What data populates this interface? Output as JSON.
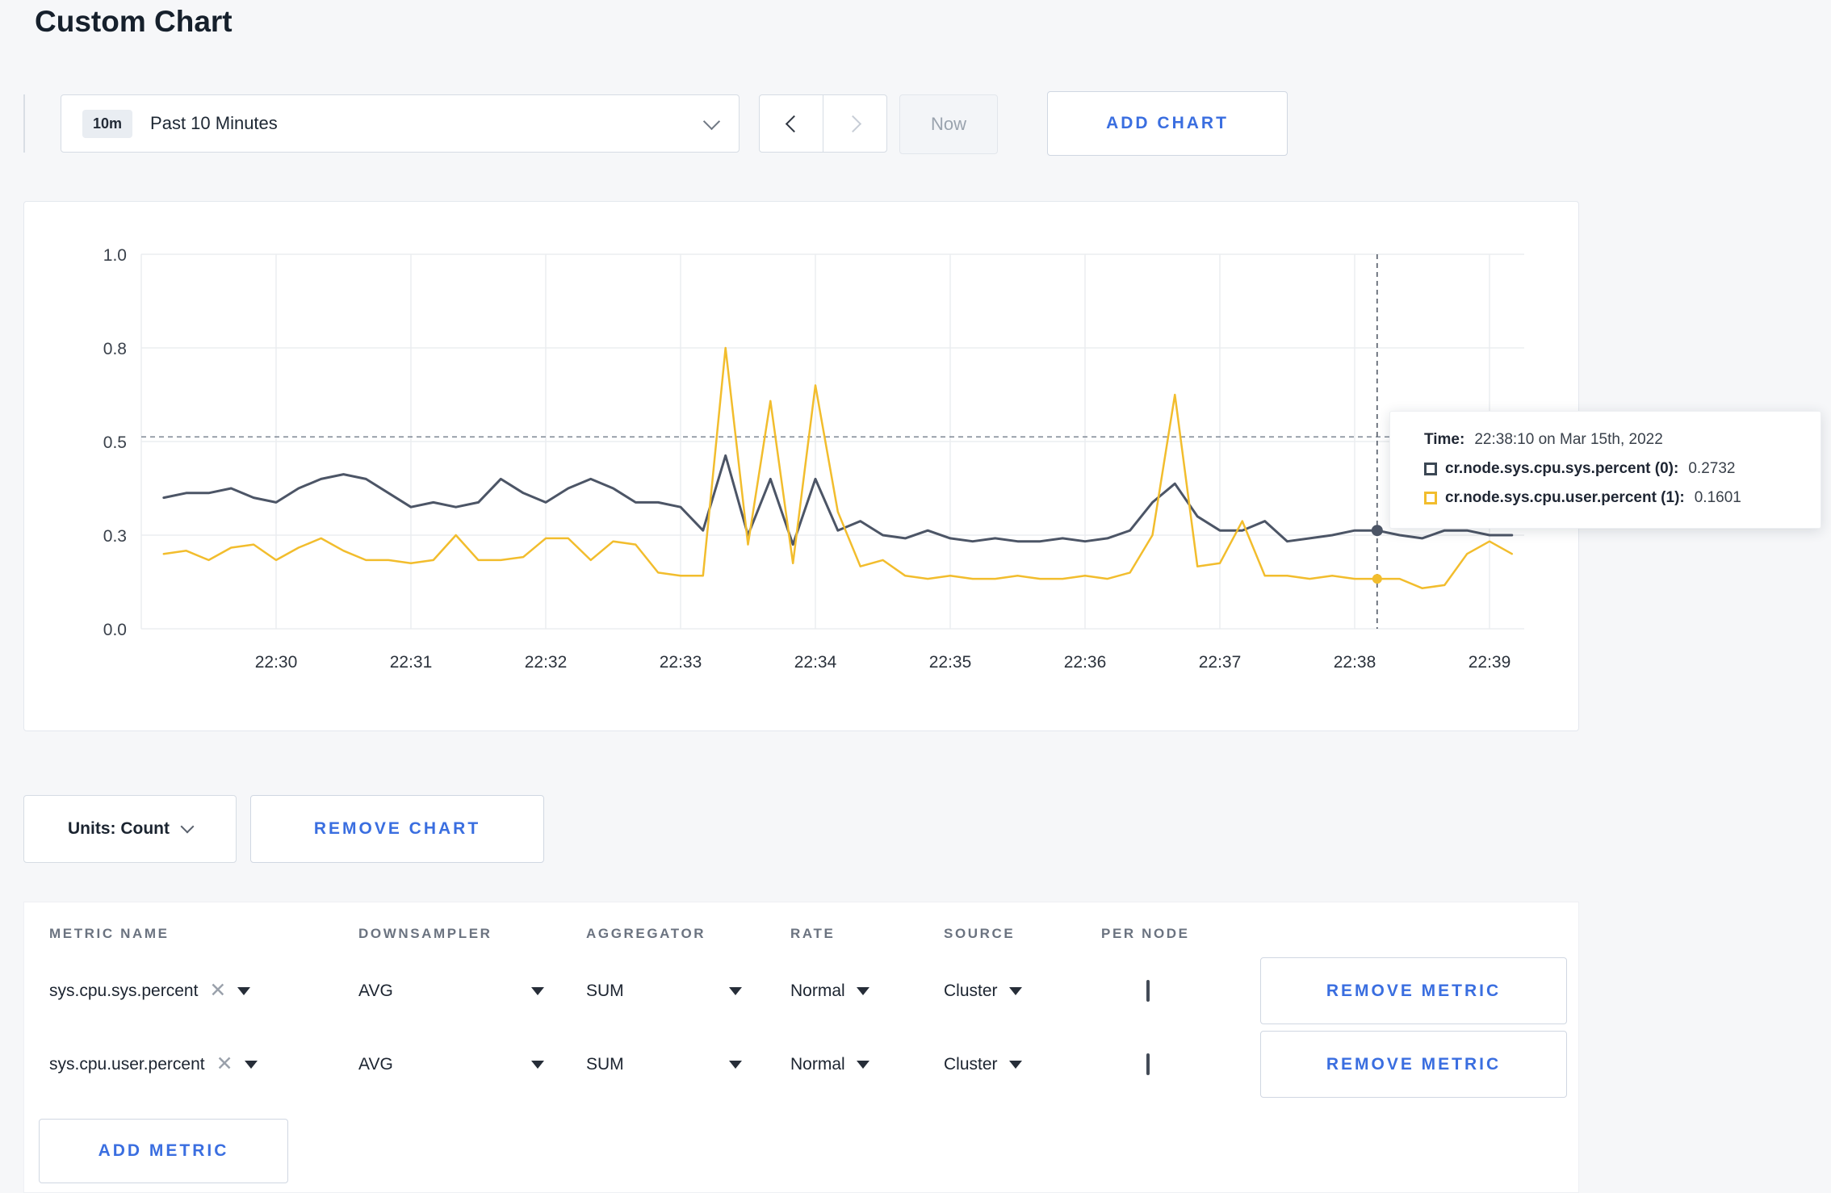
{
  "page": {
    "title": "Custom Chart"
  },
  "theme": {
    "accent_blue": "#3a6ee0",
    "background": "#f6f7f9",
    "panel_border": "#e4e8ee"
  },
  "toolbar": {
    "range_badge": "10m",
    "range_label": "Past 10 Minutes",
    "now_label": "Now",
    "add_chart_label": "ADD CHART"
  },
  "chart_data": {
    "type": "line",
    "title": "",
    "xlabel": "",
    "ylabel": "",
    "grid": true,
    "legend_position": "tooltip",
    "x_ticks": [
      "22:30",
      "22:31",
      "22:32",
      "22:33",
      "22:34",
      "22:35",
      "22:36",
      "22:37",
      "22:38",
      "22:39"
    ],
    "x_tick_seconds": [
      60,
      120,
      180,
      240,
      300,
      360,
      420,
      480,
      540,
      600
    ],
    "y_ticks": [
      "0.0",
      "0.3",
      "0.5",
      "0.8",
      "1.0"
    ],
    "y_tick_values": [
      0.0,
      0.3,
      0.5,
      0.8,
      1.0
    ],
    "x_start_time": "22:29:00",
    "t_start": 10,
    "t_step": 10,
    "series": [
      {
        "name": "cr.node.sys.cpu.sys.percent",
        "color": "#4c5566",
        "values": [
          0.38,
          0.39,
          0.39,
          0.4,
          0.38,
          0.37,
          0.4,
          0.42,
          0.43,
          0.42,
          0.39,
          0.36,
          0.37,
          0.36,
          0.37,
          0.42,
          0.39,
          0.37,
          0.4,
          0.42,
          0.4,
          0.37,
          0.37,
          0.36,
          0.31,
          0.47,
          0.3,
          0.42,
          0.27,
          0.42,
          0.31,
          0.33,
          0.3,
          0.29,
          0.31,
          0.29,
          0.28,
          0.29,
          0.28,
          0.28,
          0.29,
          0.28,
          0.29,
          0.31,
          0.37,
          0.41,
          0.34,
          0.31,
          0.31,
          0.33,
          0.28,
          0.29,
          0.3,
          0.31,
          0.31,
          0.3,
          0.29,
          0.31,
          0.31,
          0.3,
          0.3
        ]
      },
      {
        "name": "cr.node.sys.cpu.user.percent",
        "color": "#f2bd2d",
        "values": [
          0.24,
          0.25,
          0.22,
          0.26,
          0.27,
          0.22,
          0.26,
          0.29,
          0.25,
          0.22,
          0.22,
          0.21,
          0.22,
          0.3,
          0.22,
          0.22,
          0.23,
          0.29,
          0.29,
          0.22,
          0.28,
          0.27,
          0.18,
          0.17,
          0.17,
          0.8,
          0.27,
          0.63,
          0.21,
          0.68,
          0.35,
          0.2,
          0.22,
          0.17,
          0.16,
          0.17,
          0.16,
          0.16,
          0.17,
          0.16,
          0.16,
          0.17,
          0.16,
          0.18,
          0.3,
          0.65,
          0.2,
          0.21,
          0.33,
          0.17,
          0.17,
          0.16,
          0.17,
          0.16,
          0.16,
          0.16,
          0.13,
          0.14,
          0.24,
          0.28,
          0.24
        ]
      }
    ],
    "crosshair": {
      "t": 550,
      "time_label": "22:38:10",
      "hline_value": 0.515
    }
  },
  "tooltip": {
    "time_label": "Time:",
    "time_value": "22:38:10 on Mar 15th, 2022",
    "rows": [
      {
        "label": "cr.node.sys.cpu.sys.percent (0):",
        "value": "0.2732",
        "color": "#3b4754"
      },
      {
        "label": "cr.node.sys.cpu.user.percent (1):",
        "value": "0.1601",
        "color": "#f2bd2d"
      }
    ]
  },
  "controls": {
    "units_label": "Units: Count",
    "remove_chart_label": "REMOVE CHART",
    "add_metric_label": "ADD METRIC"
  },
  "table": {
    "headers": [
      "METRIC NAME",
      "DOWNSAMPLER",
      "AGGREGATOR",
      "RATE",
      "SOURCE",
      "PER NODE"
    ],
    "rows": [
      {
        "metric": "sys.cpu.sys.percent",
        "downsampler": "AVG",
        "aggregator": "SUM",
        "rate": "Normal",
        "source": "Cluster",
        "per_node_checked": false,
        "remove_label": "REMOVE METRIC"
      },
      {
        "metric": "sys.cpu.user.percent",
        "downsampler": "AVG",
        "aggregator": "SUM",
        "rate": "Normal",
        "source": "Cluster",
        "per_node_checked": false,
        "remove_label": "REMOVE METRIC"
      }
    ]
  }
}
